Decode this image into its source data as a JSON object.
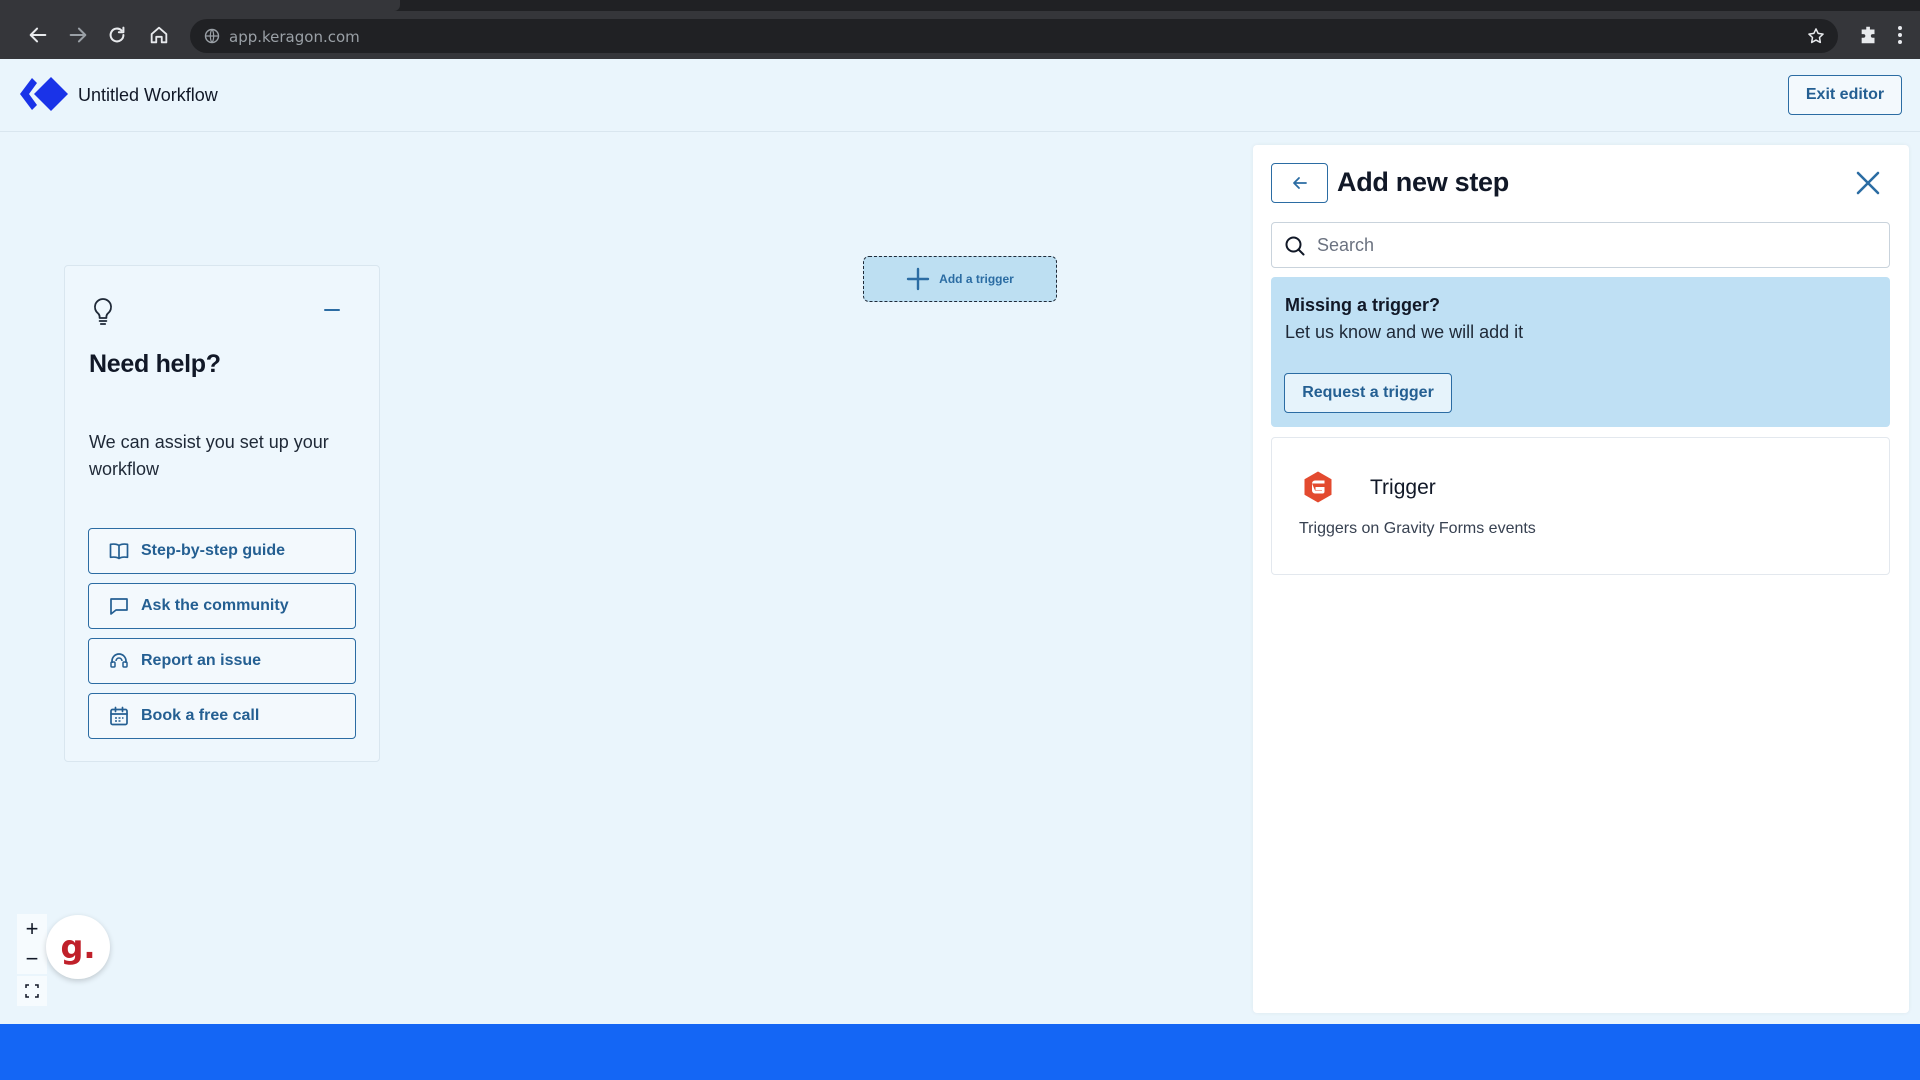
{
  "browser": {
    "url": "app.keragon.com",
    "icons": {
      "back": "arrow-left-icon",
      "forward": "arrow-right-icon",
      "reload": "reload-icon",
      "home": "home-icon",
      "site": "globe-icon",
      "bookmark": "star-icon",
      "extensions": "puzzle-icon",
      "menu": "kebab-menu-icon"
    }
  },
  "header": {
    "title": "Untitled Workflow",
    "exit_label": "Exit editor",
    "brand_color": "#1a33e8"
  },
  "help": {
    "title": "Need help?",
    "description": "We can assist you set up your workflow",
    "buttons": [
      {
        "label": "Step-by-step guide",
        "icon": "book-icon"
      },
      {
        "label": "Ask the community",
        "icon": "chat-bubble-icon"
      },
      {
        "label": "Report an issue",
        "icon": "headset-icon"
      },
      {
        "label": "Book a free call",
        "icon": "calendar-icon"
      }
    ]
  },
  "canvas": {
    "add_trigger_label": "Add a trigger",
    "zoom_in": "+",
    "zoom_out": "−",
    "badge": "g."
  },
  "panel": {
    "title": "Add new step",
    "search_placeholder": "Search",
    "missing_title": "Missing a trigger?",
    "missing_sub": "Let us know and we will add it",
    "request_label": "Request a trigger",
    "trigger": {
      "name": "Trigger",
      "description": "Triggers on Gravity Forms events",
      "icon": "gravity-forms-icon",
      "icon_color": "#e34a2f"
    }
  },
  "colors": {
    "accent": "#245f92",
    "bottom_bar": "#1466f5",
    "canvas_bg": "#eaf5fc"
  }
}
